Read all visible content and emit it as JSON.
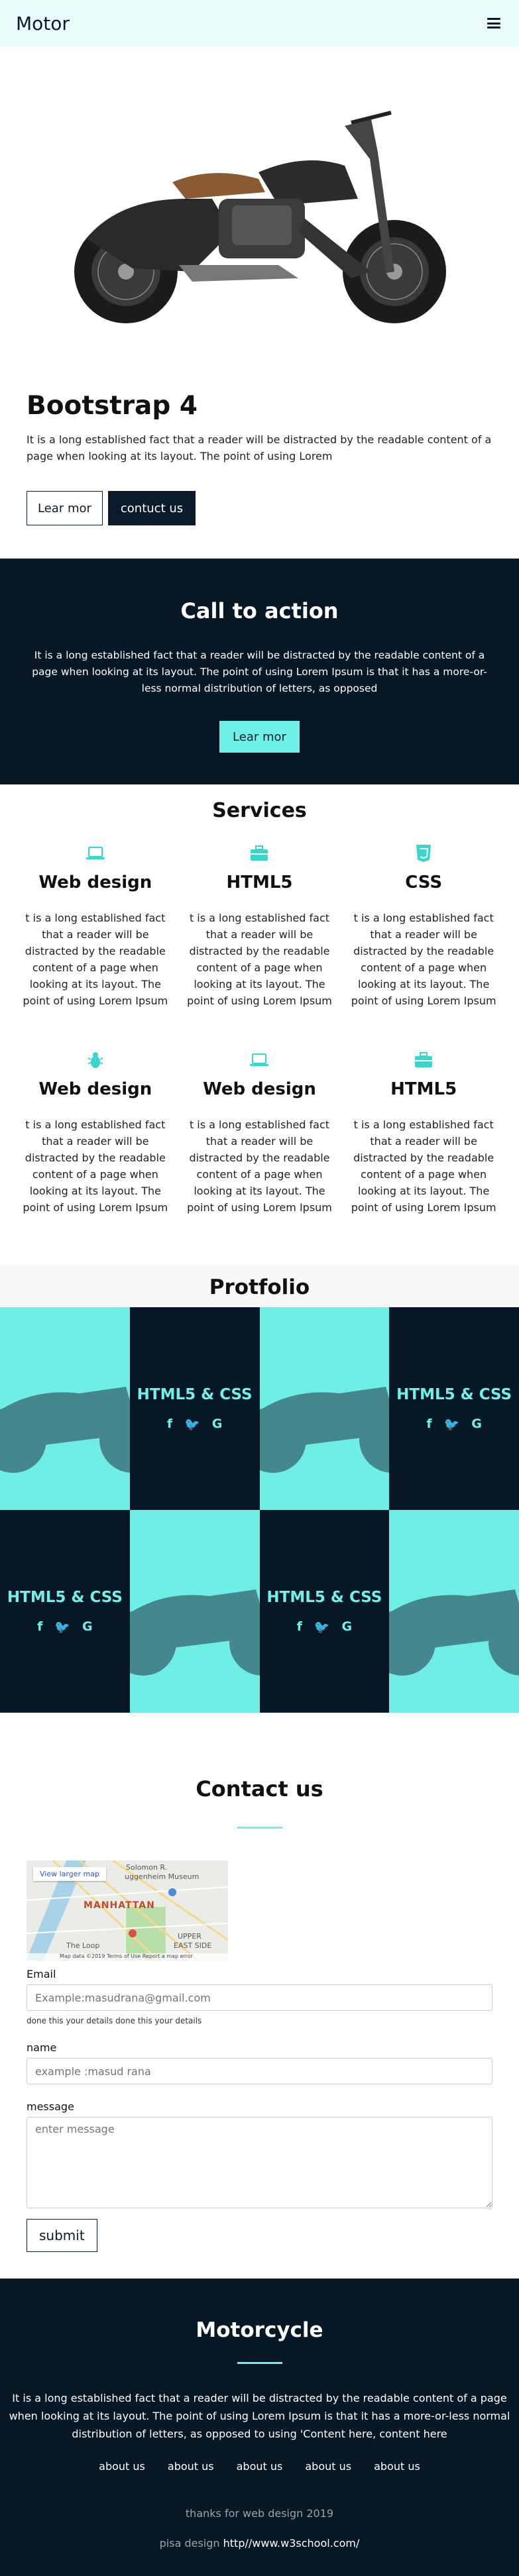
{
  "navbar": {
    "brand": "Motor",
    "menu_icon": "hamburger-icon"
  },
  "intro": {
    "title": "Bootstrap 4",
    "text": "It is a long established fact that a reader will be distracted by the readable content of a page when looking at its layout. The point of using Lorem",
    "btn_more": "Lear mor",
    "btn_contact": "contuct us"
  },
  "cta": {
    "title": "Call to action",
    "text": "It is a long established fact that a reader will be distracted by the readable content of a page when looking at its layout. The point of using Lorem Ipsum is that it has a more-or-less normal distribution of letters, as opposed",
    "button": "Lear mor"
  },
  "services": {
    "title": "Services",
    "items": [
      {
        "icon": "laptop-icon",
        "title": "Web design",
        "text": "t is a long established fact that a reader will be distracted by the readable content of a page when looking at its layout. The point of using Lorem Ipsum"
      },
      {
        "icon": "briefcase-icon",
        "title": "HTML5",
        "text": "t is a long established fact that a reader will be distracted by the readable content of a page when looking at its layout. The point of using Lorem Ipsum"
      },
      {
        "icon": "css3-icon",
        "title": "CSS",
        "text": "t is a long established fact that a reader will be distracted by the readable content of a page when looking at its layout. The point of using Lorem Ipsum"
      },
      {
        "icon": "bug-icon",
        "title": "Web design",
        "text": "t is a long established fact that a reader will be distracted by the readable content of a page when looking at its layout. The point of using Lorem Ipsum"
      },
      {
        "icon": "laptop-icon",
        "title": "Web design",
        "text": "t is a long established fact that a reader will be distracted by the readable content of a page when looking at its layout. The point of using Lorem Ipsum"
      },
      {
        "icon": "briefcase-icon",
        "title": "HTML5",
        "text": "t is a long established fact that a reader will be distracted by the readable content of a page when looking at its layout. The point of using Lorem Ipsum"
      }
    ]
  },
  "portfolio": {
    "title": "Protfolio",
    "tile_title": "HTML5 & CSS",
    "social": {
      "facebook": "f",
      "twitter": "🐦",
      "google": "G"
    }
  },
  "contact": {
    "title": "Contact us",
    "map": {
      "view_larger": "View larger map",
      "label_manhattan": "MANHATTAN",
      "label_solomon": "Solomon R.",
      "label_museum": "uggenheim Museum",
      "label_upper": "UPPER",
      "label_east": "EAST SIDE",
      "label_loop": "The Loop",
      "footer": "Map data ©2019   Terms of Use   Report a map error"
    },
    "email_label": "Email",
    "email_placeholder": "Example:masudrana@gmail.com",
    "email_help": "done this your details done this your details",
    "name_label": "name",
    "name_placeholder": "example :masud rana",
    "message_label": "message",
    "message_placeholder": "enter message",
    "submit": "submit"
  },
  "footer": {
    "title": "Motorcycle",
    "text": "It is a long established fact that a reader will be distracted by the readable content of a page when looking at its layout. The point of using Lorem Ipsum is that it has a more-or-less normal distribution of letters, as opposed to using 'Content here, content here",
    "links": [
      "about us",
      "about us",
      "about us",
      "about us",
      "about us"
    ],
    "thanks": "thanks for web design 2019",
    "credit_prefix": "pisa design",
    "credit_link": "http//www.w3school.com/"
  },
  "colors": {
    "accent": "#6ff0e8",
    "dark": "#061826",
    "nav_bg": "#e9fbfb"
  }
}
